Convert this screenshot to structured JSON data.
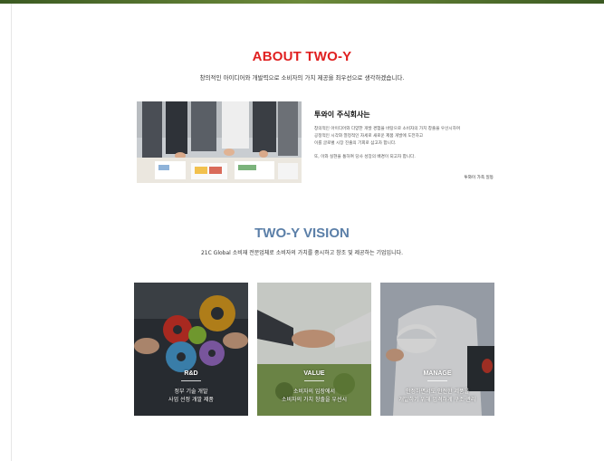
{
  "about": {
    "title": "ABOUT TWO-Y",
    "subtitle": "창의적인 아이디어와 개발력으로 소비자의 가치 제공을 최우선으로 생각하겠습니다."
  },
  "company": {
    "title": "투와이 주식회사는",
    "body_lines": [
      "창의적인 아이디어와 다양한 개발 경험을 바탕으로 소비자의 가치 창출을 우선시하며",
      "공정적인 시각와 열정적인 자세로 새로운 제품 개발에 도전하고",
      "이를 글로벌 시장 진출의 기회로 삼고자 합니다."
    ],
    "closing": "또, 이와 실현을 통하여 당사 성장의 배경이 되고자 합니다.",
    "signature": "투와이 가족 일동"
  },
  "vision": {
    "title": "TWO-Y VISION",
    "subtitle": "21C Global 소비재 전문업체로 소비자의 가치를 중시하고 창조 및 제공하는 기업입니다."
  },
  "cards": [
    {
      "label": "R&D",
      "line1": "정부 기술 개발",
      "line2": "사업 선정 개발 제품"
    },
    {
      "label": "VALUE",
      "line1": "소비자의 입장에서",
      "line2": "소비자의 가치 창출을 우선시"
    },
    {
      "label": "MANAGE",
      "line1": "안정하면서도 안전한 제품을",
      "line2": "개발하기 위해 엄격하게 구조·관리"
    }
  ],
  "colors": {
    "about_title": "#e02020",
    "vision_title": "#5b7fa8",
    "top_strip": "#4f6e2c"
  }
}
